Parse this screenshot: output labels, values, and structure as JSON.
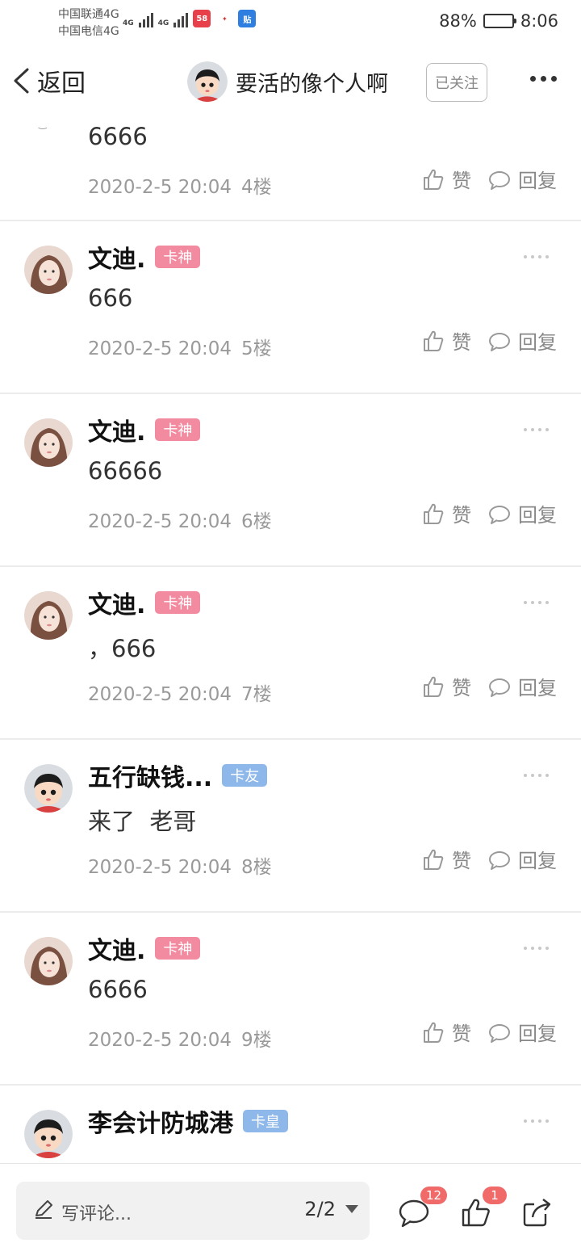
{
  "status_bar": {
    "carrier_1": "中国联通4G",
    "carrier_2": "中国电信4G",
    "network_tag": "4G",
    "battery_percent": "88%",
    "battery_level": 0.88,
    "time": "8:06",
    "app_icons": [
      "app-58-icon",
      "app-misc-icon",
      "tieba-icon"
    ]
  },
  "header": {
    "back_label": "返回",
    "title": "要活的像个人啊",
    "follow_label": "已关注",
    "more_icon": "ellipsis-icon"
  },
  "colors": {
    "badge_kashen": "#f38ba0",
    "badge_kayou": "#8fb8ea",
    "badge_kahuang": "#8fb8ea",
    "count_badge": "#f06a6a",
    "divider": "#ececec"
  },
  "labels": {
    "like": "赞",
    "reply": "回复"
  },
  "comments": [
    {
      "user": "",
      "badge": "",
      "text": "6666",
      "date": "2020-2-5 20:04",
      "floor": "4楼"
    },
    {
      "user": "文迪.",
      "badge": "卡神",
      "text": "666",
      "date": "2020-2-5 20:04",
      "floor": "5楼"
    },
    {
      "user": "文迪.",
      "badge": "卡神",
      "text": "66666",
      "date": "2020-2-5 20:04",
      "floor": "6楼"
    },
    {
      "user": "文迪.",
      "badge": "卡神",
      "text": "，666",
      "date": "2020-2-5 20:04",
      "floor": "7楼"
    },
    {
      "user": "五行缺钱...",
      "badge": "卡友",
      "text": "来了  老哥",
      "date": "2020-2-5 20:04",
      "floor": "8楼"
    },
    {
      "user": "文迪.",
      "badge": "卡神",
      "text": "6666",
      "date": "2020-2-5 20:04",
      "floor": "9楼"
    },
    {
      "user": "李会计防城港",
      "badge": "卡皇",
      "text": "",
      "date": "",
      "floor": ""
    }
  ],
  "bottom_bar": {
    "write_placeholder": "写评论...",
    "page_indicator": "2/2",
    "comment_count": "12",
    "like_count": "1",
    "icons": [
      "pen-icon",
      "comment-icon",
      "like-icon",
      "share-icon"
    ]
  }
}
